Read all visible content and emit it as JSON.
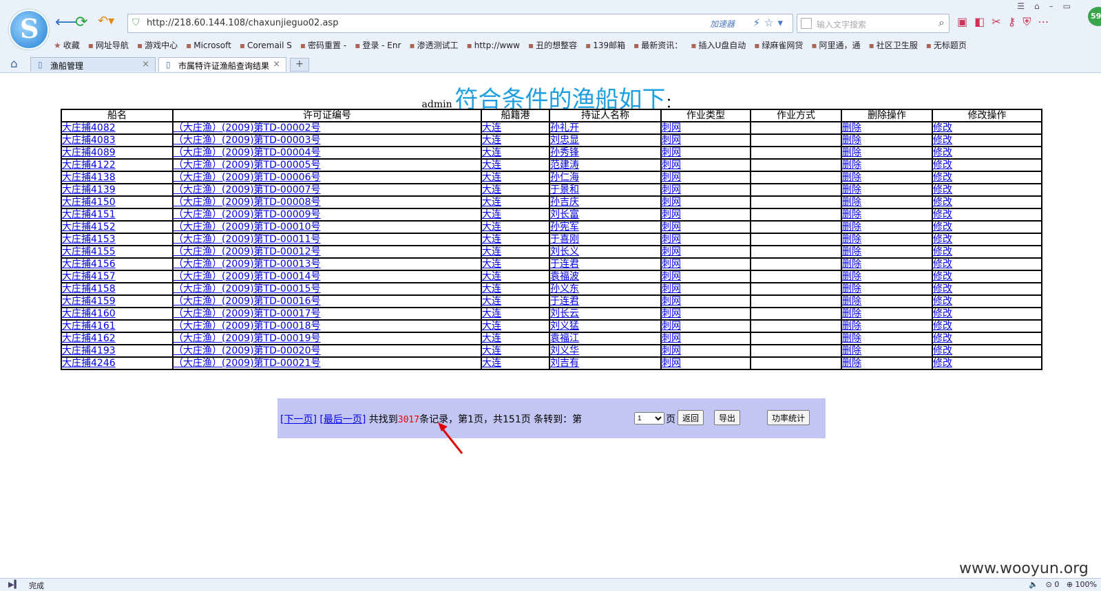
{
  "browser": {
    "url": "http://218.60.144.108/chaxunjieguo02.asp",
    "accelerator": "加速器",
    "search_placeholder": "输入文字搜索",
    "bubble": "59",
    "bookmarks": [
      "收藏",
      "网址导航",
      "游戏中心",
      "Microsoft",
      "Coremail S",
      "密码重置 -",
      "登录 - Enr",
      "渗透测试工",
      "http://www",
      "丑的想整容",
      "139邮箱",
      "最新资讯：",
      "插入U盘自动",
      "绿麻雀网贷",
      "阿里通，通",
      "社区卫生服",
      "无标题页"
    ],
    "tabs": [
      {
        "label": "渔船管理"
      },
      {
        "label": "市属特许证渔船查询结果"
      }
    ],
    "new_tab": "+",
    "status": "完成",
    "zoom": "100%",
    "download_count": "0"
  },
  "page": {
    "user": "admin",
    "title": "符合条件的渔船如下",
    "colon": "："
  },
  "table": {
    "headers": [
      "船名",
      "许可证编号",
      "船籍港",
      "持证人名称",
      "作业类型",
      "作业方式",
      "删除操作",
      "修改操作"
    ],
    "rows": [
      [
        "大庄捕4082",
        "（大庄渔）(2009)第TD-00002号",
        "大连",
        "孙礼开",
        "刺网",
        "",
        "删除",
        "修改"
      ],
      [
        "大庄捕4083",
        "（大庄渔）(2009)第TD-00003号",
        "大连",
        "刘忠显",
        "刺网",
        "",
        "删除",
        "修改"
      ],
      [
        "大庄捕4089",
        "（大庄渔）(2009)第TD-00004号",
        "大连",
        "孙秀锋",
        "刺网",
        "",
        "删除",
        "修改"
      ],
      [
        "大庄捕4122",
        "（大庄渔）(2009)第TD-00005号",
        "大连",
        "范建涛",
        "刺网",
        "",
        "删除",
        "修改"
      ],
      [
        "大庄捕4138",
        "（大庄渔）(2009)第TD-00006号",
        "大连",
        "孙仁海",
        "刺网",
        "",
        "删除",
        "修改"
      ],
      [
        "大庄捕4139",
        "（大庄渔）(2009)第TD-00007号",
        "大连",
        "于景和",
        "刺网",
        "",
        "删除",
        "修改"
      ],
      [
        "大庄捕4150",
        "（大庄渔）(2009)第TD-00008号",
        "大连",
        "孙吉庆",
        "刺网",
        "",
        "删除",
        "修改"
      ],
      [
        "大庄捕4151",
        "（大庄渔）(2009)第TD-00009号",
        "大连",
        "刘长富",
        "刺网",
        "",
        "删除",
        "修改"
      ],
      [
        "大庄捕4152",
        "（大庄渔）(2009)第TD-00010号",
        "大连",
        "孙宪军",
        "刺网",
        "",
        "删除",
        "修改"
      ],
      [
        "大庄捕4153",
        "（大庄渔）(2009)第TD-00011号",
        "大连",
        "于喜刚",
        "刺网",
        "",
        "删除",
        "修改"
      ],
      [
        "大庄捕4155",
        "（大庄渔）(2009)第TD-00012号",
        "大连",
        "刘长义",
        "刺网",
        "",
        "删除",
        "修改"
      ],
      [
        "大庄捕4156",
        "（大庄渔）(2009)第TD-00013号",
        "大连",
        "于连君",
        "刺网",
        "",
        "删除",
        "修改"
      ],
      [
        "大庄捕4157",
        "（大庄渔）(2009)第TD-00014号",
        "大连",
        "袁福波",
        "刺网",
        "",
        "删除",
        "修改"
      ],
      [
        "大庄捕4158",
        "（大庄渔）(2009)第TD-00015号",
        "大连",
        "孙义东",
        "刺网",
        "",
        "删除",
        "修改"
      ],
      [
        "大庄捕4159",
        "（大庄渔）(2009)第TD-00016号",
        "大连",
        "于连君",
        "刺网",
        "",
        "删除",
        "修改"
      ],
      [
        "大庄捕4160",
        "（大庄渔）(2009)第TD-00017号",
        "大连",
        "刘长云",
        "刺网",
        "",
        "删除",
        "修改"
      ],
      [
        "大庄捕4161",
        "（大庄渔）(2009)第TD-00018号",
        "大连",
        "刘义猛",
        "刺网",
        "",
        "删除",
        "修改"
      ],
      [
        "大庄捕4162",
        "（大庄渔）(2009)第TD-00019号",
        "大连",
        "袁福江",
        "刺网",
        "",
        "删除",
        "修改"
      ],
      [
        "大庄捕4193",
        "（大庄渔）(2009)第TD-00020号",
        "大连",
        "刘义华",
        "刺网",
        "",
        "删除",
        "修改"
      ],
      [
        "大庄捕4246",
        "（大庄渔）(2009)第TD-00021号",
        "大连",
        "刘吉有",
        "刺网",
        "",
        "删除",
        "修改"
      ]
    ]
  },
  "pager": {
    "next": "[下一页]",
    "last": "[最后一页]",
    "found_prefix": "共找到",
    "count": "3017",
    "found_suffix": "条记录，第1页，共151页 条转到：第",
    "page_option": "1",
    "page_suffix": "页",
    "back": "返回",
    "export": "导出",
    "stats": "功率统计"
  },
  "watermark": "www.wooyun.org",
  "colors": {
    "title": "#1ea0e0",
    "count": "#ee0000",
    "pager_bg": "#c3c6f3",
    "annotation_arrow": "#e00000"
  }
}
